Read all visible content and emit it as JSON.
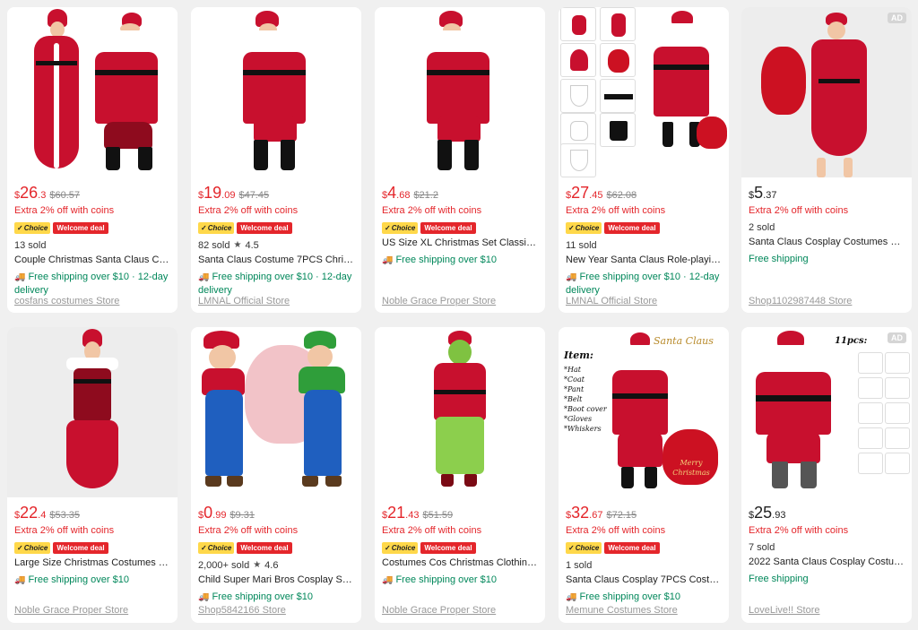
{
  "products": [
    {
      "currency": "$",
      "price_int": "26",
      "price_dec": ".3",
      "orig": "$60.57",
      "extra": "Extra 2% off with coins",
      "choice": "Choice",
      "welcome": "Welcome deal",
      "sold": "13 sold",
      "rating": "",
      "title": "Couple Christmas Santa Claus Cos...",
      "ship": "Free shipping over $10 · 12-day delivery",
      "store": "cosfans costumes Store",
      "ad": ""
    },
    {
      "currency": "$",
      "price_int": "19",
      "price_dec": ".09",
      "orig": "$47.45",
      "extra": "Extra 2% off with coins",
      "choice": "Choice",
      "welcome": "Welcome deal",
      "sold": "82 sold",
      "rating": "4.5",
      "title": "Santa Claus Costume 7PCS Christ...",
      "ship": "Free shipping over $10 · 12-day delivery",
      "store": "LMNAL Official Store",
      "ad": ""
    },
    {
      "currency": "$",
      "price_int": "4",
      "price_dec": ".68",
      "orig": "$21.2",
      "extra": "Extra 2% off with coins",
      "choice": "Choice",
      "welcome": "Welcome deal",
      "sold": "",
      "rating": "",
      "title": "US Size XL Christmas Set Classic 7 ...",
      "ship": "Free shipping over $10",
      "store": "Noble Grace Proper Store",
      "ad": ""
    },
    {
      "currency": "$",
      "price_int": "27",
      "price_dec": ".45",
      "orig": "$62.08",
      "extra": "Extra 2% off with coins",
      "choice": "Choice",
      "welcome": "Welcome deal",
      "sold": "11 sold",
      "rating": "",
      "title": "New Year Santa Claus Role-playing...",
      "ship": "Free shipping over $10 · 12-day delivery",
      "store": "LMNAL Official Store",
      "ad": ""
    },
    {
      "currency": "$",
      "price_int": "5",
      "price_dec": ".37",
      "orig": "",
      "extra": "Extra 2% off with coins",
      "choice": "",
      "welcome": "",
      "sold": "2 sold",
      "rating": "",
      "title": "Santa Claus Cosplay Costumes Hat...",
      "ship": "Free shipping",
      "store": "Shop1102987448 Store",
      "ad": "AD"
    },
    {
      "currency": "$",
      "price_int": "22",
      "price_dec": ".4",
      "orig": "$53.35",
      "extra": "Extra 2% off with coins",
      "choice": "Choice",
      "welcome": "Welcome deal",
      "sold": "",
      "rating": "",
      "title": "Large Size Christmas Costumes for...",
      "ship": "Free shipping over $10",
      "store": "Noble Grace Proper Store",
      "ad": ""
    },
    {
      "currency": "$",
      "price_int": "0",
      "price_dec": ".99",
      "orig": "$9.31",
      "extra": "Extra 2% off with coins",
      "choice": "Choice",
      "welcome": "Welcome deal",
      "sold": "2,000+ sold",
      "rating": "4.6",
      "title": "Child Super Mari Bros Cosplay Suit...",
      "ship": "Free shipping over $10",
      "store": "Shop5842166 Store",
      "ad": ""
    },
    {
      "currency": "$",
      "price_int": "21",
      "price_dec": ".43",
      "orig": "$51.59",
      "extra": "Extra 2% off with coins",
      "choice": "Choice",
      "welcome": "Welcome deal",
      "sold": "",
      "rating": "",
      "title": "Costumes Cos Christmas Clothing ...",
      "ship": "Free shipping over $10",
      "store": "Noble Grace Proper Store",
      "ad": ""
    },
    {
      "currency": "$",
      "price_int": "32",
      "price_dec": ".67",
      "orig": "$72.15",
      "extra": "Extra 2% off with coins",
      "choice": "Choice",
      "welcome": "Welcome deal",
      "sold": "1 sold",
      "rating": "",
      "title": "Santa Claus Cosplay 7PCS Costum...",
      "ship": "Free shipping over $10",
      "store": "Memune Costumes Store",
      "ad": ""
    },
    {
      "currency": "$",
      "price_int": "25",
      "price_dec": ".93",
      "orig": "",
      "extra": "Extra 2% off with coins",
      "choice": "",
      "welcome": "",
      "sold": "7 sold",
      "rating": "",
      "title": "2022 Santa Claus Cosplay Costum...",
      "ship": "Free shipping",
      "store": "LoveLive!! Store",
      "ad": "AD"
    }
  ],
  "image_text": {
    "item_list_heading": "Item:",
    "item_list": [
      "*Hat",
      "*Coat",
      "*Pant",
      "*Belt",
      "*Boot cover",
      "*Gloves",
      "*Whiskers"
    ],
    "santa_claus_logo": "Santa Claus",
    "eleven_pcs": "11pcs:",
    "merry_christmas": "Merry Christmas"
  },
  "colors": {
    "price": "#e4262b",
    "shipping": "#00875a",
    "choice_badge": "#ffd84a",
    "welcome_badge": "#e4262b"
  },
  "icons": {
    "truck": "truck-icon",
    "star": "star-icon"
  }
}
